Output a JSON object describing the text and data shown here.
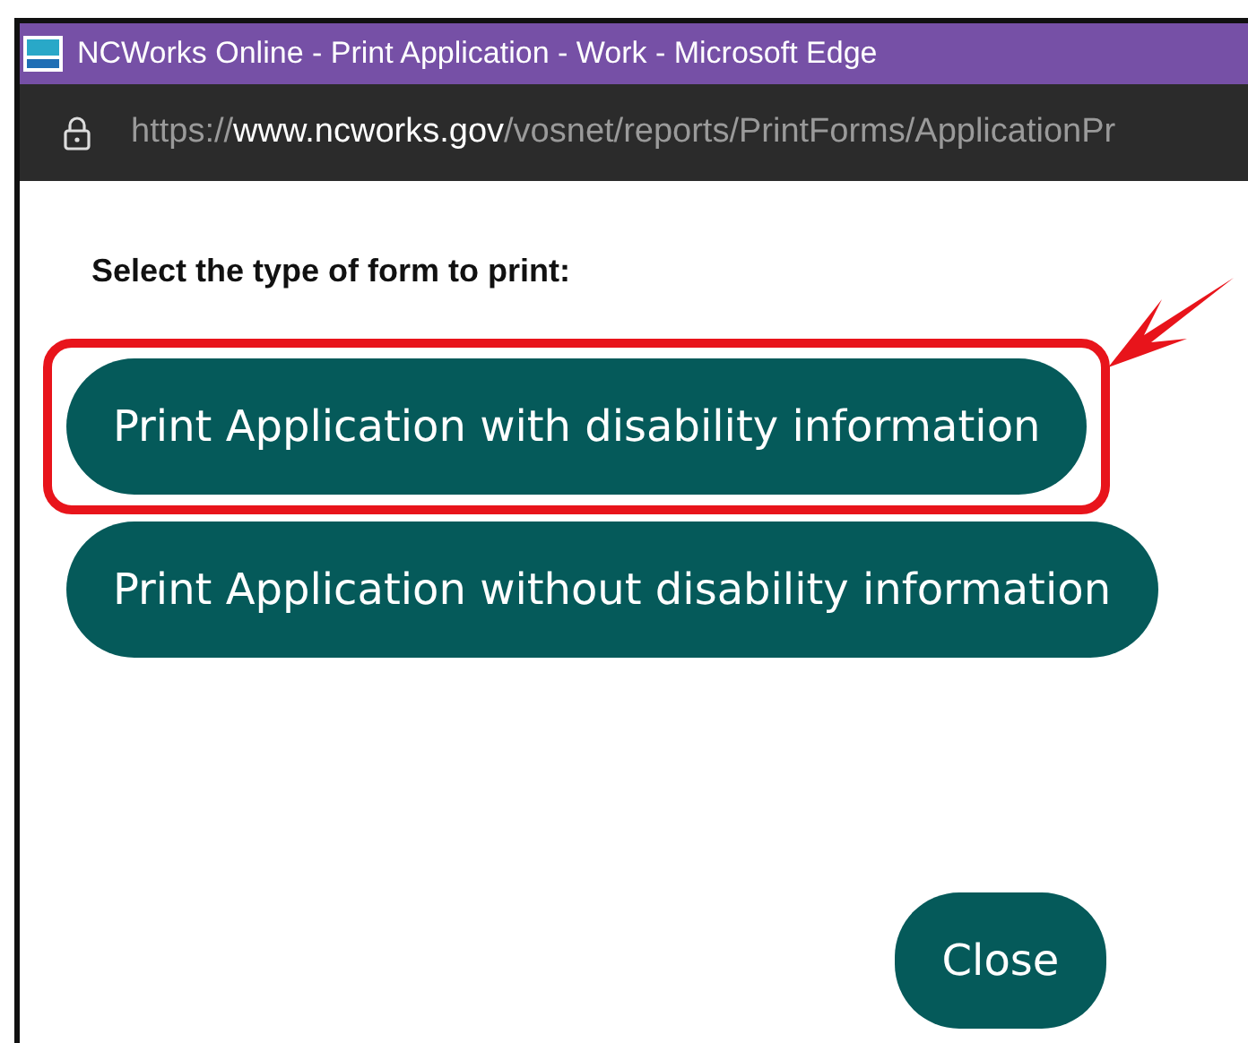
{
  "window": {
    "title": "NCWorks Online - Print Application - Work - Microsoft Edge"
  },
  "address_bar": {
    "url": "https://**www.ncworks.gov**/vosnet/reports/PrintForms/ApplicationPr"
  },
  "prompt": "Select the type of form to print:",
  "options": [
    {
      "label": "Print Application with disability information",
      "highlighted": true
    },
    {
      "label": "Print Application without disability information",
      "highlighted": false
    }
  ],
  "close_button": "Close"
}
